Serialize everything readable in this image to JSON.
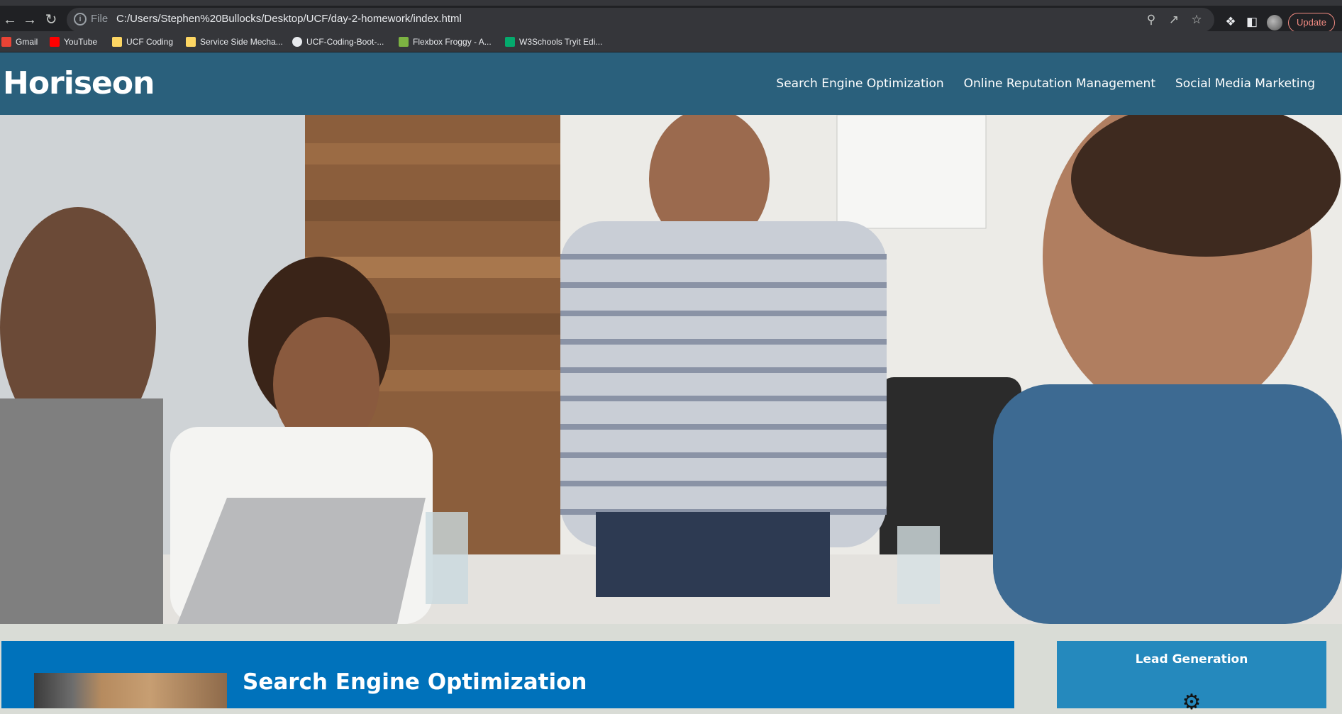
{
  "browser": {
    "omnibox": {
      "scheme_label": "File",
      "url": "C:/Users/Stephen%20Bullocks/Desktop/UCF/day-2-homework/index.html"
    },
    "update_label": "Update",
    "bookmarks": [
      {
        "label": "Gmail",
        "color": "#ea4335"
      },
      {
        "label": "YouTube",
        "color": "#ff0000"
      },
      {
        "label": "UCF Coding",
        "color": "#fdd663"
      },
      {
        "label": "Service Side Mecha...",
        "color": "#fdd663"
      },
      {
        "label": "UCF-Coding-Boot-...",
        "color": "#e8eaed"
      },
      {
        "label": "Flexbox Froggy - A...",
        "color": "#7cb342"
      },
      {
        "label": "W3Schools Tryit Edi...",
        "color": "#04aa6d"
      }
    ]
  },
  "site": {
    "brand": "Horiseon",
    "nav": [
      "Search Engine Optimization",
      "Online Reputation Management",
      "Social Media Marketing"
    ],
    "content_title": "Search Engine Optimization",
    "aside_title": "Lead Generation"
  },
  "colors": {
    "header_bg": "#2a607c",
    "content_bg": "#0072bb",
    "aside_bg": "#2589bd",
    "page_bg": "#d9dcd6"
  }
}
